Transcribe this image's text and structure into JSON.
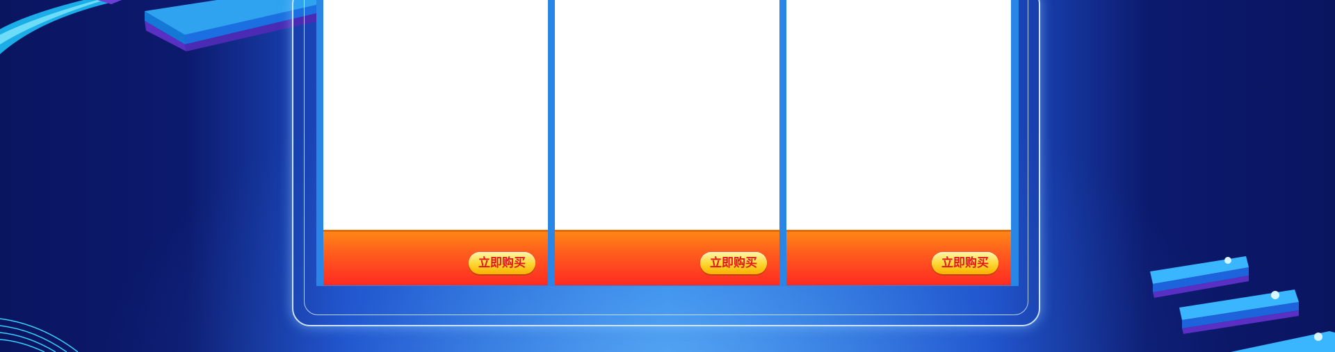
{
  "products": [
    {
      "buy_label": "立即购买"
    },
    {
      "buy_label": "立即购买"
    },
    {
      "buy_label": "立即购买"
    }
  ],
  "colors": {
    "background_dark": "#0a1560",
    "background_light": "#2a86e6",
    "frame_stroke": "#d7ebff",
    "bar_top": "#ff8a14",
    "bar_bottom": "#ff2a22",
    "button_fill": "#ffd52e",
    "button_text": "#e1161e"
  }
}
